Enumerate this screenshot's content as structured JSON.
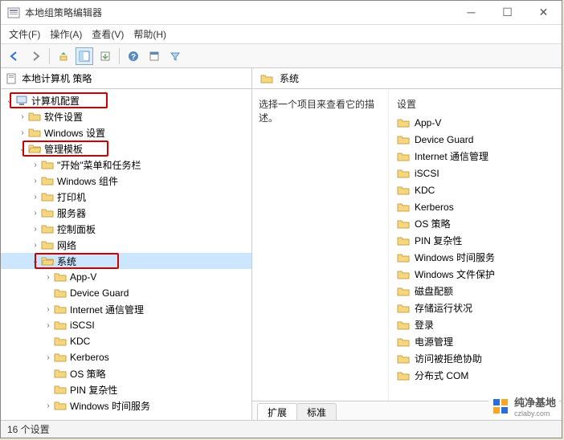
{
  "titlebar": {
    "title": "本地组策略编辑器"
  },
  "menu": {
    "file": "文件(F)",
    "action": "操作(A)",
    "view": "查看(V)",
    "help": "帮助(H)"
  },
  "header": {
    "left": "本地计算机 策略",
    "right": "系统"
  },
  "description": "选择一个项目来查看它的描述。",
  "settings_label": "设置",
  "tree": {
    "root": "计算机配置",
    "software": "软件设置",
    "windows_settings": "Windows 设置",
    "admin_templates": "管理模板",
    "start": "\"开始\"菜单和任务栏",
    "components": "Windows 组件",
    "printer": "打印机",
    "server": "服务器",
    "control_panel": "控制面板",
    "network": "网络",
    "system": "系统",
    "appv": "App-V",
    "device_guard": "Device Guard",
    "internet": "Internet 通信管理",
    "iscsi": "iSCSI",
    "kdc": "KDC",
    "kerberos": "Kerberos",
    "os_policy": "OS 策略",
    "pin": "PIN 复杂性",
    "time": "Windows 时间服务"
  },
  "list": {
    "items": [
      "App-V",
      "Device Guard",
      "Internet 通信管理",
      "iSCSI",
      "KDC",
      "Kerberos",
      "OS 策略",
      "PIN 复杂性",
      "Windows 时间服务",
      "Windows 文件保护",
      "磁盘配额",
      "存储运行状况",
      "登录",
      "电源管理",
      "访问被拒绝协助",
      "分布式 COM"
    ]
  },
  "tabs": {
    "extended": "扩展",
    "standard": "标准"
  },
  "status": "16 个设置",
  "watermark": {
    "site": "纯净基地",
    "url": "czlaby.com"
  }
}
